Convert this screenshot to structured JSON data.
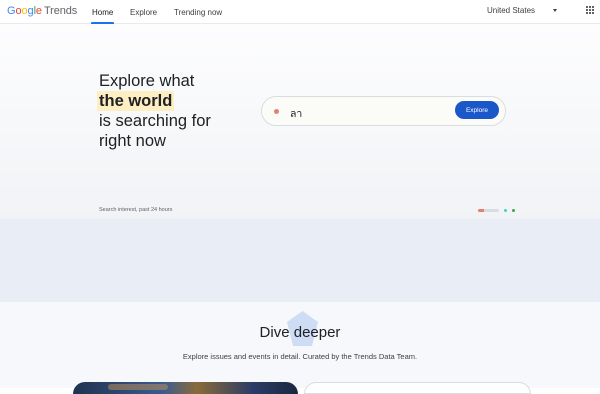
{
  "header": {
    "logo": {
      "google": [
        "G",
        "o",
        "o",
        "g",
        "l",
        "e"
      ],
      "product": "Trends"
    },
    "nav": [
      {
        "label": "Home",
        "active": true
      },
      {
        "label": "Explore",
        "active": false
      },
      {
        "label": "Trending now",
        "active": false
      }
    ],
    "country": {
      "selected": "United States"
    },
    "icons": {
      "country_dropdown": "chevron-down-icon",
      "apps": "apps-grid-icon"
    }
  },
  "hero": {
    "headline_line1": "Explore what",
    "headline_highlight": "the world",
    "headline_line3": "is searching for",
    "headline_line4": "right now",
    "search": {
      "value": "ลา",
      "button_label": "Explore"
    },
    "interest_label": "Search interest, past 24 hours",
    "carousel": {
      "progress": 1.0,
      "colors": [
        "#e57f6f",
        "#4ecdc4",
        "#34a853"
      ]
    }
  },
  "dive": {
    "title": "Dive deeper",
    "subtitle": "Explore issues and events in detail. Curated by the Trends Data Team."
  },
  "colors": {
    "accent": "#1a57c8",
    "nav_indicator": "#1a73e8",
    "highlight": "#feefc3"
  }
}
